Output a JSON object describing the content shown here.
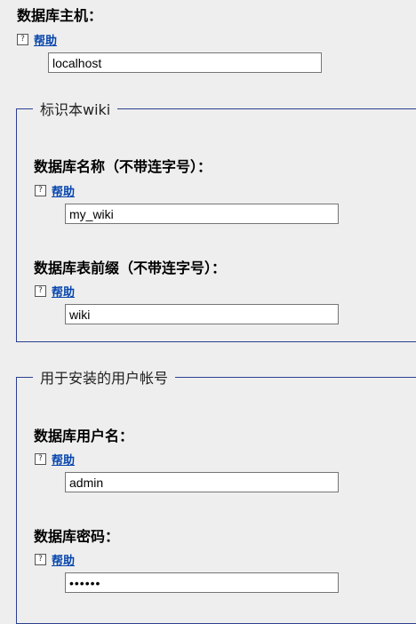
{
  "help_label": "帮助",
  "help_icon_glyph": "?",
  "db_host": {
    "label": "数据库主机：",
    "value": "localhost"
  },
  "wiki_group": {
    "legend": "标识本wiki",
    "db_name": {
      "label": "数据库名称（不带连字号）：",
      "value": "my_wiki"
    },
    "table_prefix": {
      "label": "数据库表前缀（不带连字号）：",
      "value": "wiki"
    }
  },
  "install_account_group": {
    "legend": "用于安装的用户帐号",
    "db_user": {
      "label": "数据库用户名：",
      "value": "admin"
    },
    "db_password": {
      "label": "数据库密码：",
      "value": "abc123"
    }
  }
}
